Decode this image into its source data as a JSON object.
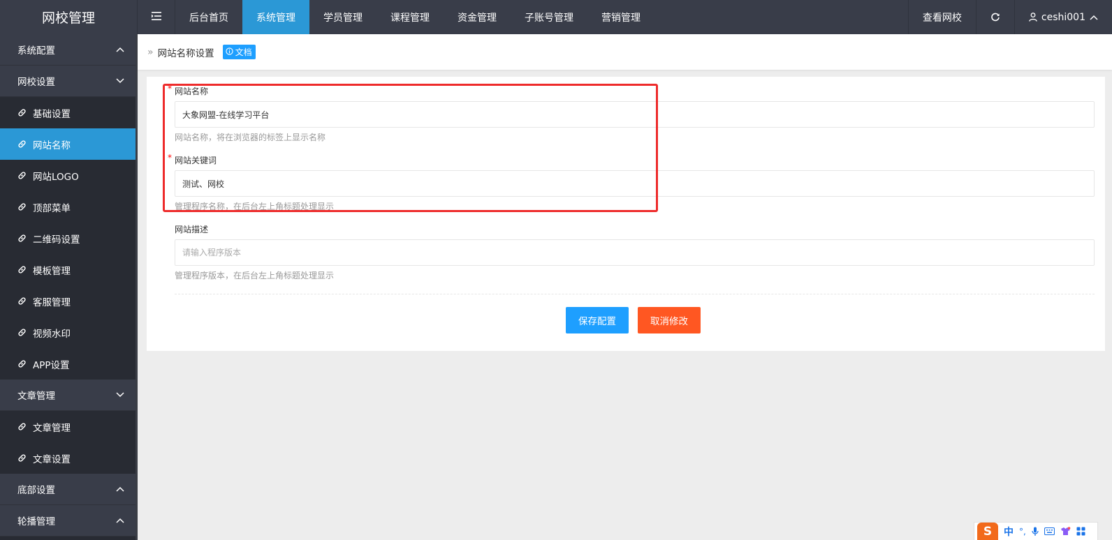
{
  "brand": {
    "title": "网校管理"
  },
  "nav": {
    "items": [
      {
        "label": "后台首页",
        "active": false
      },
      {
        "label": "系统管理",
        "active": true
      },
      {
        "label": "学员管理",
        "active": false
      },
      {
        "label": "课程管理",
        "active": false
      },
      {
        "label": "资金管理",
        "active": false
      },
      {
        "label": "子账号管理",
        "active": false
      },
      {
        "label": "营销管理",
        "active": false
      }
    ]
  },
  "topright": {
    "view_site": "查看网校",
    "username": "ceshi001"
  },
  "sidebar": {
    "groups": [
      {
        "label": "系统配置"
      },
      {
        "label": "网校设置"
      },
      {
        "label": "文章管理"
      },
      {
        "label": "底部设置"
      },
      {
        "label": "轮播管理"
      }
    ],
    "site_items": [
      {
        "label": "基础设置"
      },
      {
        "label": "网站名称"
      },
      {
        "label": "网站LOGO"
      },
      {
        "label": "顶部菜单"
      },
      {
        "label": "二维码设置"
      },
      {
        "label": "模板管理"
      },
      {
        "label": "客服管理"
      },
      {
        "label": "视频水印"
      },
      {
        "label": "APP设置"
      }
    ],
    "article_items": [
      {
        "label": "文章管理"
      },
      {
        "label": "文章设置"
      }
    ]
  },
  "breadcrumb": {
    "arrow": "»",
    "text": "网站名称设置",
    "doc_label": "文档"
  },
  "form": {
    "site_name": {
      "label": "网站名称",
      "required": "*",
      "value": "大象网盟-在线学习平台",
      "hint": "网站名称，将在浏览器的标签上显示名称"
    },
    "keywords": {
      "label": "网站关键词",
      "required": "*",
      "value": "测试、网校",
      "hint": "管理程序名称，在后台左上角标题处理显示"
    },
    "description": {
      "label": "网站描述",
      "placeholder": "请输入程序版本",
      "value": "",
      "hint": "管理程序版本，在后台左上角标题处理显示"
    },
    "save_label": "保存配置",
    "cancel_label": "取消修改"
  },
  "ime": {
    "logo": "S",
    "lang": "中",
    "punct": "°,"
  },
  "colors": {
    "topbar": "#393d49",
    "sidebar": "#282b33",
    "accent": "#2b98d6",
    "primary": "#1e9fff",
    "danger": "#ff5722",
    "highlight": "#ee2b2b"
  }
}
